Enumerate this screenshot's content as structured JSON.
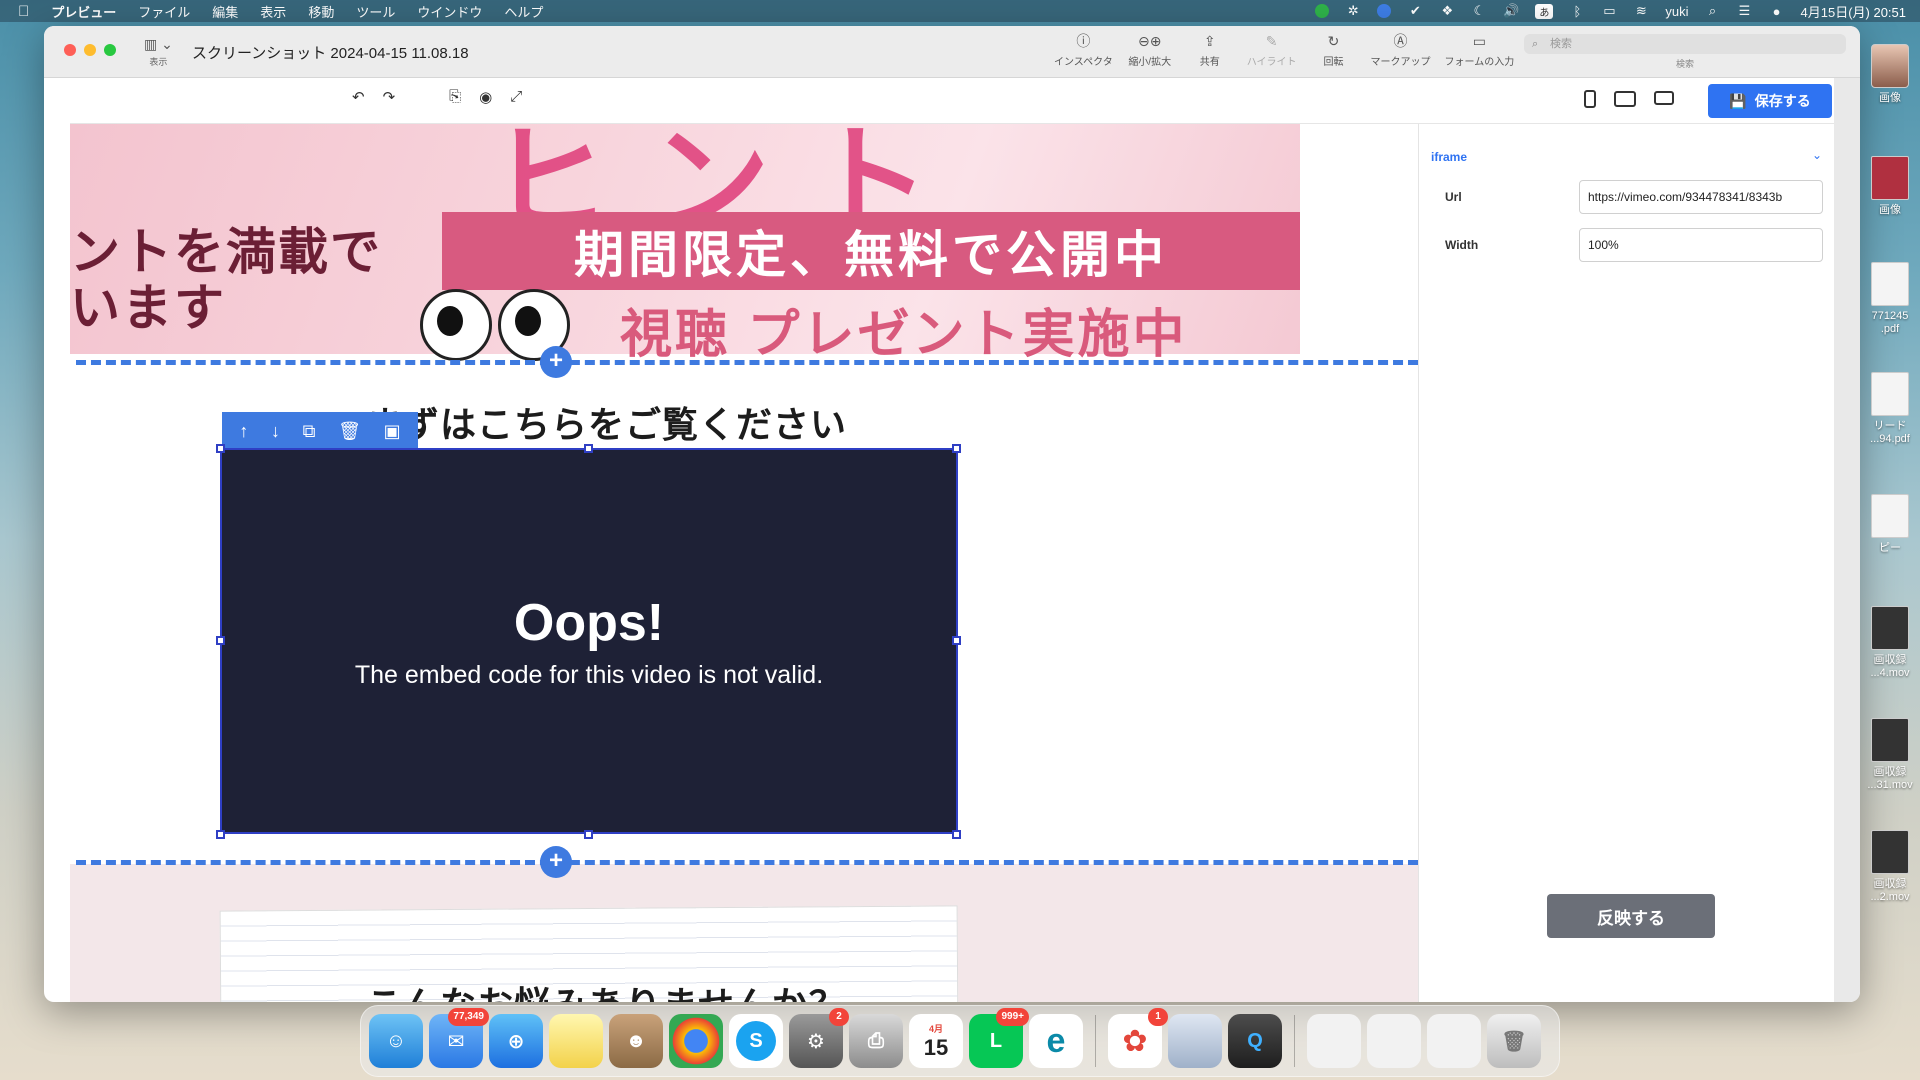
{
  "menubar": {
    "app_name": "プレビュー",
    "items": [
      "ファイル",
      "編集",
      "表示",
      "移動",
      "ツール",
      "ウインドウ",
      "ヘルプ"
    ],
    "user": "yuki",
    "datetime": "4月15日(月) 20:51",
    "ime_label": "あ"
  },
  "window": {
    "title": "スクリーンショット 2024-04-15 11.08.18",
    "sidebar_label": "表示",
    "tools": [
      {
        "label": "インスペクタ",
        "icon": "ⓘ"
      },
      {
        "label": "縮小/拡大",
        "icon": "⊖⊕"
      },
      {
        "label": "共有",
        "icon": "⇪"
      },
      {
        "label": "ハイライト",
        "icon": "✎"
      },
      {
        "label": "回転",
        "icon": "↻"
      },
      {
        "label": "マークアップ",
        "icon": "Ⓐ"
      },
      {
        "label": "フォームの入力",
        "icon": "▭"
      }
    ],
    "search_placeholder": "検索",
    "search_label": "検索"
  },
  "builder": {
    "save_label": "保存する",
    "banner": {
      "stripe_text": "期間限定、無料で公開中",
      "left_text": "ントを満載で\nいます",
      "sub_text": "視聴 プレゼント実施中",
      "big_text": "ヒント"
    },
    "section_title": "まずはこちらをご覧ください",
    "video": {
      "heading": "Oops!",
      "message": "The embed code for this video is not valid."
    },
    "next_title": "こんなお悩みありませんか？",
    "panel": {
      "header": "iframe",
      "url_label": "Url",
      "url_value": "https://vimeo.com/934478341/8343b",
      "width_label": "Width",
      "width_value": "100%",
      "apply_label": "反映する"
    }
  },
  "desktop_items": [
    {
      "caption": "画像",
      "type": "avatar"
    },
    {
      "caption": "画像",
      "type": "red"
    },
    {
      "caption": "771245\n.pdf",
      "type": "pdf"
    },
    {
      "caption": "リード\n...94.pdf",
      "type": "pdf"
    },
    {
      "caption": "ピー",
      "type": "pdf"
    },
    {
      "caption": "画収録\n...4.mov",
      "type": "dark"
    },
    {
      "caption": "画収録\n...31.mov",
      "type": "dark"
    },
    {
      "caption": "画収録\n...2.mov",
      "type": "dark"
    }
  ],
  "dock": {
    "mail_badge": "77,349",
    "settings_badge": "2",
    "line_badge": "999+",
    "calendar_month": "4月",
    "calendar_day": "15",
    "app_badge": "1"
  }
}
